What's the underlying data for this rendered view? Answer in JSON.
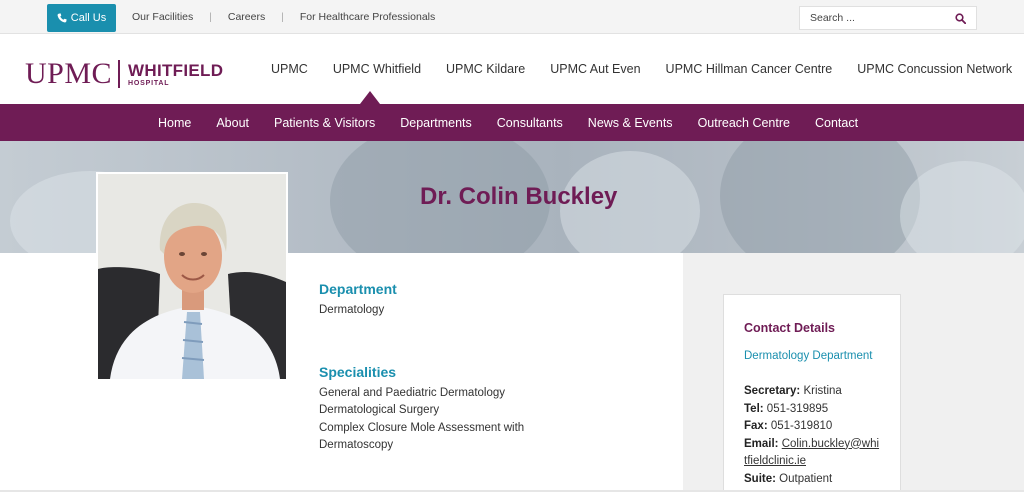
{
  "topbar": {
    "call_label": "Call Us",
    "links": [
      "Our Facilities",
      "Careers",
      "For Healthcare Professionals"
    ],
    "search_placeholder": "Search ..."
  },
  "logo": {
    "brand": "UPMC",
    "hospital": "WHITFIELD",
    "hospital_sub": "HOSPITAL"
  },
  "main_nav": [
    "UPMC",
    "UPMC Whitfield",
    "UPMC Kildare",
    "UPMC Aut Even",
    "UPMC Hillman Cancer Centre",
    "UPMC Concussion Network"
  ],
  "sub_nav": [
    "Home",
    "About",
    "Patients & Visitors",
    "Departments",
    "Consultants",
    "News & Events",
    "Outreach Centre",
    "Contact"
  ],
  "profile": {
    "name": "Dr. Colin Buckley",
    "department_heading": "Department",
    "department": "Dermatology",
    "specialities_heading": "Specialities",
    "specialities": [
      "General and Paediatric Dermatology",
      "Dermatological Surgery",
      "Complex Closure Mole Assessment with Dermatoscopy"
    ]
  },
  "contact": {
    "heading": "Contact Details",
    "department_link": "Dermatology Department",
    "secretary_label": "Secretary:",
    "secretary": "Kristina",
    "tel_label": "Tel:",
    "tel": "051-319895",
    "fax_label": "Fax:",
    "fax": "051-319810",
    "email_label": "Email:",
    "email_line1": "Colin.buckley@whi",
    "email_line2": "tfieldclinic.ie",
    "suite_label": "Suite:",
    "suite": "Outpatient"
  },
  "colors": {
    "brand_purple": "#6f1c55",
    "accent_teal": "#1a8fae"
  },
  "icons": {
    "call": "phone-icon",
    "search": "search-icon"
  }
}
